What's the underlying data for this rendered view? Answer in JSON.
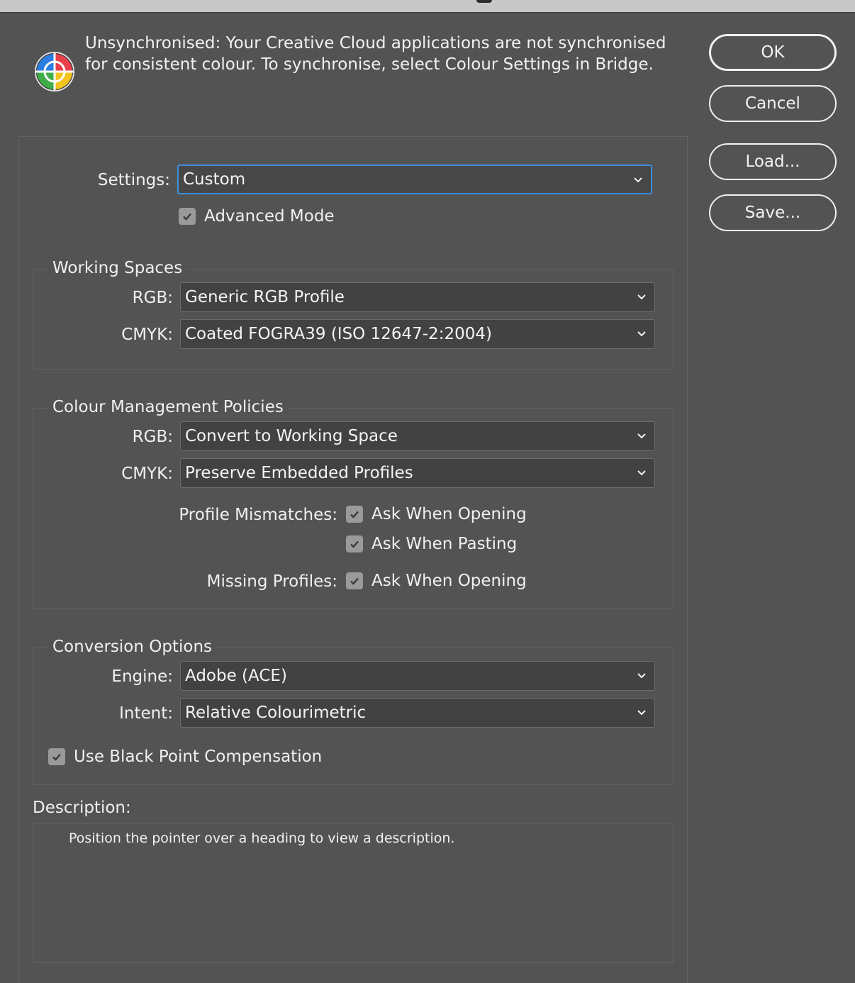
{
  "banner": {
    "line1": "Unsynchronised: Your Creative Cloud applications are not synchronised",
    "line2": "for consistent colour. To synchronise, select Colour Settings in Bridge."
  },
  "buttons": {
    "ok": "OK",
    "cancel": "Cancel",
    "load": "Load...",
    "save": "Save..."
  },
  "settings": {
    "label": "Settings:",
    "value": "Custom",
    "advanced_mode_label": "Advanced Mode",
    "advanced_mode_checked": true
  },
  "working_spaces": {
    "title": "Working Spaces",
    "rgb_label": "RGB:",
    "rgb_value": "Generic RGB Profile",
    "cmyk_label": "CMYK:",
    "cmyk_value": "Coated FOGRA39 (ISO 12647-2:2004)"
  },
  "policies": {
    "title": "Colour Management Policies",
    "rgb_label": "RGB:",
    "rgb_value": "Convert to Working Space",
    "cmyk_label": "CMYK:",
    "cmyk_value": "Preserve Embedded Profiles",
    "profile_mismatches_label": "Profile Mismatches:",
    "ask_when_opening_label": "Ask When Opening",
    "ask_when_pasting_label": "Ask When Pasting",
    "missing_profiles_label": "Missing Profiles:",
    "missing_ask_when_opening_label": "Ask When Opening"
  },
  "conversion": {
    "title": "Conversion Options",
    "engine_label": "Engine:",
    "engine_value": "Adobe (ACE)",
    "intent_label": "Intent:",
    "intent_value": "Relative Colourimetric",
    "black_point_label": "Use Black Point Compensation"
  },
  "description": {
    "label": "Description:",
    "text": "Position the pointer over a heading to view a description."
  },
  "colors": {
    "dialog_bg": "#535353",
    "focus_ring": "#3d8fe0",
    "checkbox_fill": "#9a9a9a"
  }
}
